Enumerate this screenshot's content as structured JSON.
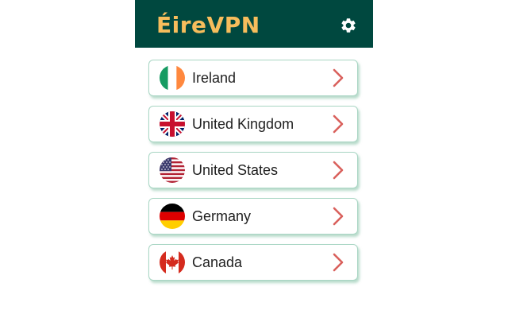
{
  "header": {
    "brand": "ÉireVPN",
    "settings_icon": "gear-icon"
  },
  "colors": {
    "header_bg": "#00483f",
    "brand": "#f7bd5c",
    "chevron": "#d9605c",
    "item_border": "#a9d6c4"
  },
  "servers": [
    {
      "label": "Ireland",
      "flag": "ireland-flag-icon"
    },
    {
      "label": "United Kingdom",
      "flag": "uk-flag-icon"
    },
    {
      "label": "United States",
      "flag": "us-flag-icon"
    },
    {
      "label": "Germany",
      "flag": "germany-flag-icon"
    },
    {
      "label": "Canada",
      "flag": "canada-flag-icon"
    }
  ]
}
